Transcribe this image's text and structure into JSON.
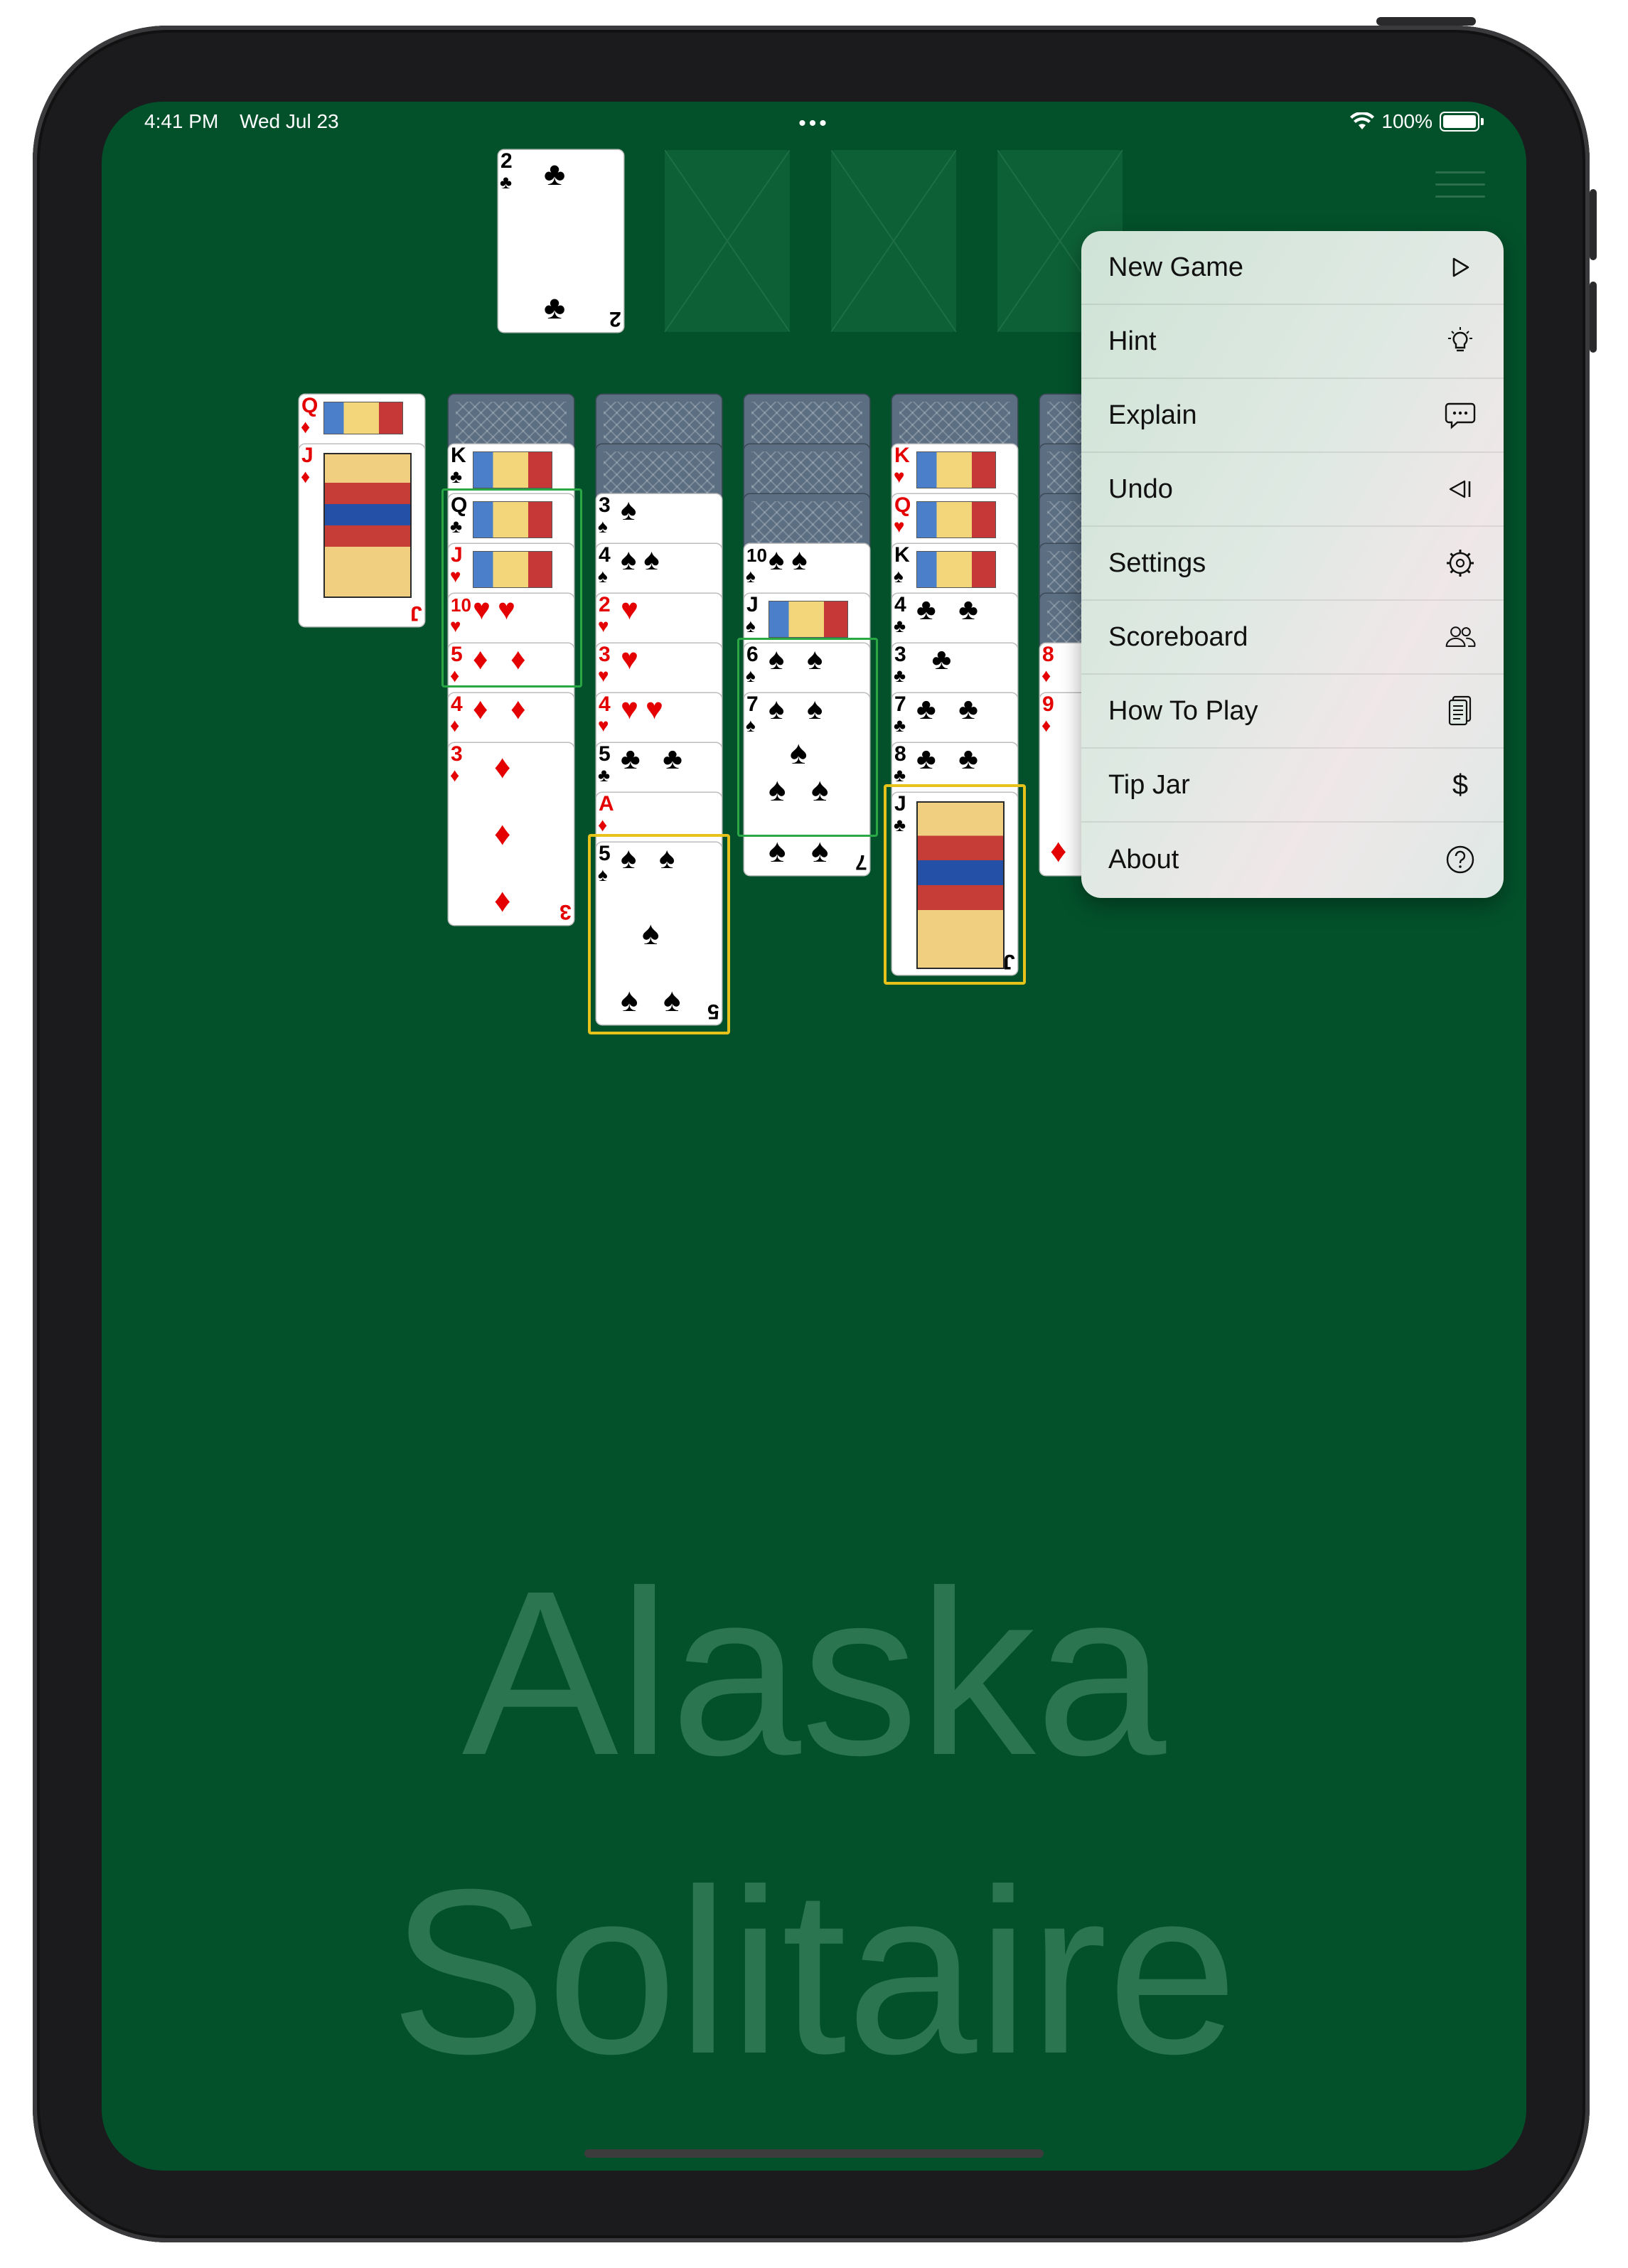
{
  "status_bar": {
    "time": "4:41 PM",
    "date": "Wed Jul 23",
    "battery": "100%",
    "dots": "•••"
  },
  "game": {
    "title_line1": "Alaska",
    "title_line2": "Solitaire",
    "foundation": [
      {
        "rank": "2",
        "suit": "♣",
        "color": "black"
      }
    ],
    "tableau": [
      {
        "column": 1,
        "cards": [
          "Q♦",
          "J♦"
        ]
      },
      {
        "column": 2,
        "cards": [
          "K♣",
          "Q♣",
          "J♥",
          "10♥",
          "5♦",
          "4♦",
          "3♦"
        ]
      },
      {
        "column": 3,
        "cards": [
          "3♠",
          "4♠",
          "2♥",
          "3♥",
          "4♥",
          "5♣",
          "A♦",
          "5♠"
        ]
      },
      {
        "column": 4,
        "cards": [
          "10♠",
          "J♠",
          "6♠",
          "7♠"
        ]
      },
      {
        "column": 5,
        "cards": [
          "K♥",
          "Q♥",
          "K♠",
          "4♣",
          "3♣",
          "7♣",
          "8♣",
          "J♣"
        ]
      },
      {
        "column": 6,
        "cards": [
          "8♦",
          "9♦"
        ]
      }
    ]
  },
  "menu": {
    "items": [
      {
        "label": "New Game",
        "icon": "play-icon"
      },
      {
        "label": "Hint",
        "icon": "lightbulb-icon"
      },
      {
        "label": "Explain",
        "icon": "speech-bubble-icon"
      },
      {
        "label": "Undo",
        "icon": "undo-icon"
      },
      {
        "label": "Settings",
        "icon": "gear-icon"
      },
      {
        "label": "Scoreboard",
        "icon": "people-icon"
      },
      {
        "label": "How To Play",
        "icon": "document-icon"
      },
      {
        "label": "Tip Jar",
        "icon": "dollar-icon"
      },
      {
        "label": "About",
        "icon": "question-icon"
      }
    ]
  },
  "colors": {
    "table": "#03512b",
    "highlight_green": "#2aa845",
    "highlight_yellow": "#e6c21a",
    "red_suit": "#e40000"
  }
}
